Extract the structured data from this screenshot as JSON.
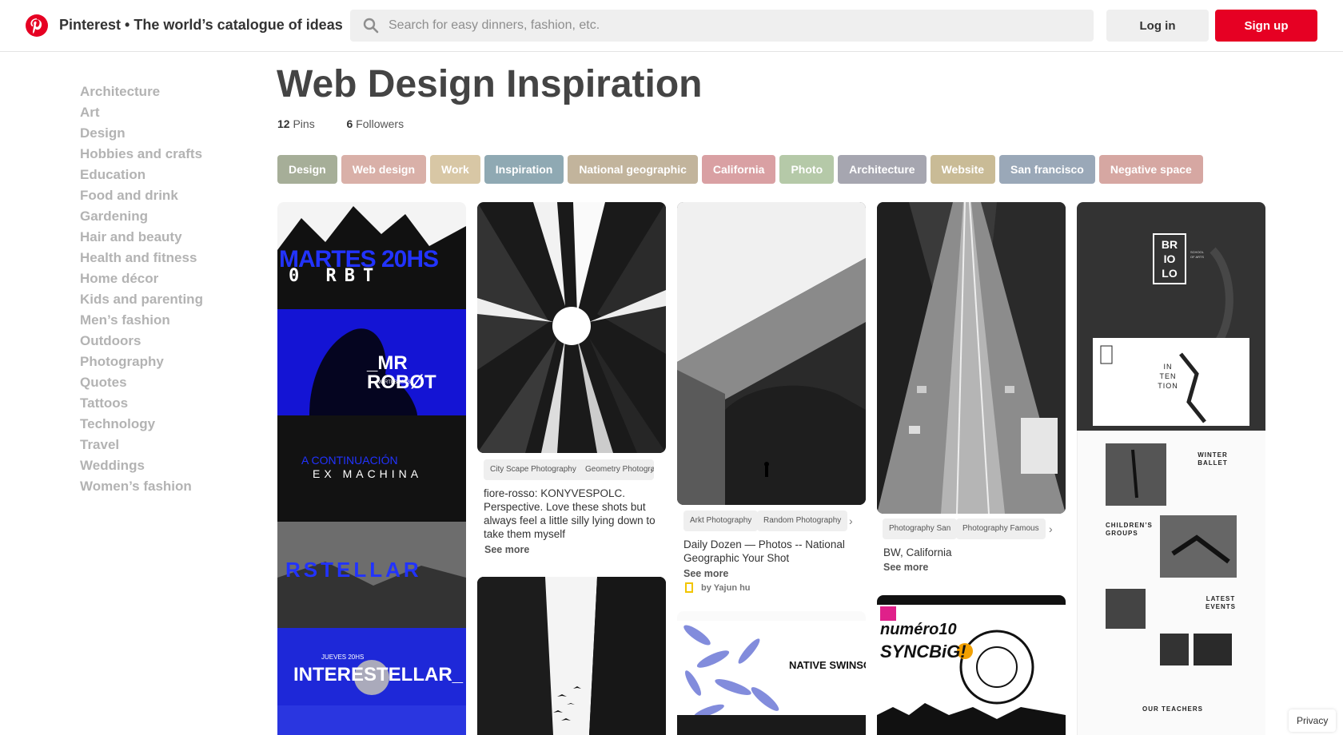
{
  "header": {
    "brand": "Pinterest • The world’s catalogue of ideas",
    "search_placeholder": "Search for easy dinners, fashion, etc.",
    "login_label": "Log in",
    "signup_label": "Sign up",
    "accent": "#e60023"
  },
  "sidebar": {
    "items": [
      {
        "label": "Architecture"
      },
      {
        "label": "Art"
      },
      {
        "label": "Design"
      },
      {
        "label": "Hobbies and crafts"
      },
      {
        "label": "Education"
      },
      {
        "label": "Food and drink"
      },
      {
        "label": "Gardening"
      },
      {
        "label": "Hair and beauty"
      },
      {
        "label": "Health and fitness"
      },
      {
        "label": "Home décor"
      },
      {
        "label": "Kids and parenting"
      },
      {
        "label": "Men’s fashion"
      },
      {
        "label": "Outdoors"
      },
      {
        "label": "Photography"
      },
      {
        "label": "Quotes"
      },
      {
        "label": "Tattoos"
      },
      {
        "label": "Technology"
      },
      {
        "label": "Travel"
      },
      {
        "label": "Weddings"
      },
      {
        "label": "Women’s fashion"
      }
    ]
  },
  "board": {
    "title": "Web Design Inspiration",
    "pins_count": "12",
    "pins_label": "Pins",
    "followers_count": "6",
    "followers_label": "Followers"
  },
  "tags": [
    {
      "label": "Design",
      "color": "#a6ae98"
    },
    {
      "label": "Web design",
      "color": "#d9b0a8"
    },
    {
      "label": "Work",
      "color": "#d8c7a5"
    },
    {
      "label": "Inspiration",
      "color": "#8fa9b3"
    },
    {
      "label": "National geographic",
      "color": "#c2b49c"
    },
    {
      "label": "California",
      "color": "#d9a0a3"
    },
    {
      "label": "Photo",
      "color": "#b5c9a8"
    },
    {
      "label": "Architecture",
      "color": "#a6a6b0"
    },
    {
      "label": "Website",
      "color": "#c9bb96"
    },
    {
      "label": "San francisco",
      "color": "#9aa8b8"
    },
    {
      "label": "Negative space",
      "color": "#d6a7a2"
    }
  ],
  "pins": {
    "mrrobot": {
      "title_top": "MARTES 20HS",
      "robot_text": "0 RBT",
      "mr_robot": "_MR ROBØT",
      "martes_small": "MARTES 20HS",
      "continuacion": "A CONTINUACIÓN",
      "ex_machina": "EX MACHINA",
      "interstellar_letters": "RSTELLAR",
      "jueves": "JUEVES 20HS",
      "interestellar": "INTERESTELLAR_"
    },
    "city": {
      "chips": [
        "City Scape Photography",
        "Geometry Photography"
      ],
      "description": "fiore-rosso: KONYVESPOLC. Perspective. Love these shots but always feel a little silly lying down to take them myself",
      "see_more": "See more"
    },
    "bridge": {
      "chips": [
        "Arkt Photography",
        "Random Photography"
      ],
      "description": "Daily Dozen — Photos -- National Geographic Your Shot",
      "see_more": "See more",
      "byline": "by Yajun hu"
    },
    "street": {
      "chips": [
        "Photography San",
        "Photography Famous"
      ],
      "description": "BW, California",
      "see_more": "See more"
    },
    "native": {
      "headline": "NATIVE SWINSO"
    },
    "numero": {
      "headline": "numéro10",
      "sub": "SYNCBiG!"
    },
    "briolo": {
      "logo": "BR IO LO",
      "school": "SCHOOL OF ARTS",
      "intention": "IN TEN TION",
      "winter": "WINTER BALLET",
      "children": "CHILDREN’S GROUPS",
      "latest": "LATEST EVENTS",
      "teachers": "OUR TEACHERS"
    }
  },
  "footer": {
    "privacy": "Privacy"
  }
}
